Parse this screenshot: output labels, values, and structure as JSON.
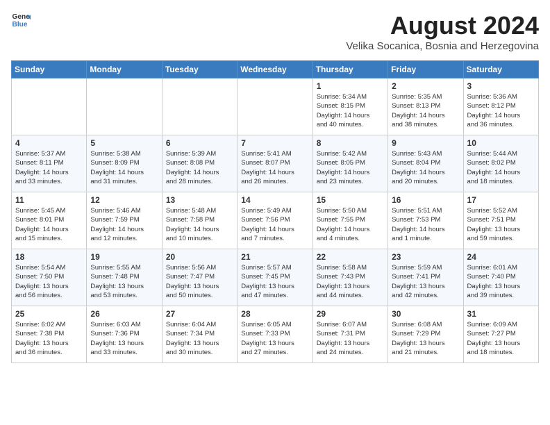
{
  "header": {
    "logo_general": "General",
    "logo_blue": "Blue",
    "month_title": "August 2024",
    "location": "Velika Socanica, Bosnia and Herzegovina"
  },
  "weekdays": [
    "Sunday",
    "Monday",
    "Tuesday",
    "Wednesday",
    "Thursday",
    "Friday",
    "Saturday"
  ],
  "weeks": [
    [
      {
        "day": "",
        "info": ""
      },
      {
        "day": "",
        "info": ""
      },
      {
        "day": "",
        "info": ""
      },
      {
        "day": "",
        "info": ""
      },
      {
        "day": "1",
        "info": "Sunrise: 5:34 AM\nSunset: 8:15 PM\nDaylight: 14 hours\nand 40 minutes."
      },
      {
        "day": "2",
        "info": "Sunrise: 5:35 AM\nSunset: 8:13 PM\nDaylight: 14 hours\nand 38 minutes."
      },
      {
        "day": "3",
        "info": "Sunrise: 5:36 AM\nSunset: 8:12 PM\nDaylight: 14 hours\nand 36 minutes."
      }
    ],
    [
      {
        "day": "4",
        "info": "Sunrise: 5:37 AM\nSunset: 8:11 PM\nDaylight: 14 hours\nand 33 minutes."
      },
      {
        "day": "5",
        "info": "Sunrise: 5:38 AM\nSunset: 8:09 PM\nDaylight: 14 hours\nand 31 minutes."
      },
      {
        "day": "6",
        "info": "Sunrise: 5:39 AM\nSunset: 8:08 PM\nDaylight: 14 hours\nand 28 minutes."
      },
      {
        "day": "7",
        "info": "Sunrise: 5:41 AM\nSunset: 8:07 PM\nDaylight: 14 hours\nand 26 minutes."
      },
      {
        "day": "8",
        "info": "Sunrise: 5:42 AM\nSunset: 8:05 PM\nDaylight: 14 hours\nand 23 minutes."
      },
      {
        "day": "9",
        "info": "Sunrise: 5:43 AM\nSunset: 8:04 PM\nDaylight: 14 hours\nand 20 minutes."
      },
      {
        "day": "10",
        "info": "Sunrise: 5:44 AM\nSunset: 8:02 PM\nDaylight: 14 hours\nand 18 minutes."
      }
    ],
    [
      {
        "day": "11",
        "info": "Sunrise: 5:45 AM\nSunset: 8:01 PM\nDaylight: 14 hours\nand 15 minutes."
      },
      {
        "day": "12",
        "info": "Sunrise: 5:46 AM\nSunset: 7:59 PM\nDaylight: 14 hours\nand 12 minutes."
      },
      {
        "day": "13",
        "info": "Sunrise: 5:48 AM\nSunset: 7:58 PM\nDaylight: 14 hours\nand 10 minutes."
      },
      {
        "day": "14",
        "info": "Sunrise: 5:49 AM\nSunset: 7:56 PM\nDaylight: 14 hours\nand 7 minutes."
      },
      {
        "day": "15",
        "info": "Sunrise: 5:50 AM\nSunset: 7:55 PM\nDaylight: 14 hours\nand 4 minutes."
      },
      {
        "day": "16",
        "info": "Sunrise: 5:51 AM\nSunset: 7:53 PM\nDaylight: 14 hours\nand 1 minute."
      },
      {
        "day": "17",
        "info": "Sunrise: 5:52 AM\nSunset: 7:51 PM\nDaylight: 13 hours\nand 59 minutes."
      }
    ],
    [
      {
        "day": "18",
        "info": "Sunrise: 5:54 AM\nSunset: 7:50 PM\nDaylight: 13 hours\nand 56 minutes."
      },
      {
        "day": "19",
        "info": "Sunrise: 5:55 AM\nSunset: 7:48 PM\nDaylight: 13 hours\nand 53 minutes."
      },
      {
        "day": "20",
        "info": "Sunrise: 5:56 AM\nSunset: 7:47 PM\nDaylight: 13 hours\nand 50 minutes."
      },
      {
        "day": "21",
        "info": "Sunrise: 5:57 AM\nSunset: 7:45 PM\nDaylight: 13 hours\nand 47 minutes."
      },
      {
        "day": "22",
        "info": "Sunrise: 5:58 AM\nSunset: 7:43 PM\nDaylight: 13 hours\nand 44 minutes."
      },
      {
        "day": "23",
        "info": "Sunrise: 5:59 AM\nSunset: 7:41 PM\nDaylight: 13 hours\nand 42 minutes."
      },
      {
        "day": "24",
        "info": "Sunrise: 6:01 AM\nSunset: 7:40 PM\nDaylight: 13 hours\nand 39 minutes."
      }
    ],
    [
      {
        "day": "25",
        "info": "Sunrise: 6:02 AM\nSunset: 7:38 PM\nDaylight: 13 hours\nand 36 minutes."
      },
      {
        "day": "26",
        "info": "Sunrise: 6:03 AM\nSunset: 7:36 PM\nDaylight: 13 hours\nand 33 minutes."
      },
      {
        "day": "27",
        "info": "Sunrise: 6:04 AM\nSunset: 7:34 PM\nDaylight: 13 hours\nand 30 minutes."
      },
      {
        "day": "28",
        "info": "Sunrise: 6:05 AM\nSunset: 7:33 PM\nDaylight: 13 hours\nand 27 minutes."
      },
      {
        "day": "29",
        "info": "Sunrise: 6:07 AM\nSunset: 7:31 PM\nDaylight: 13 hours\nand 24 minutes."
      },
      {
        "day": "30",
        "info": "Sunrise: 6:08 AM\nSunset: 7:29 PM\nDaylight: 13 hours\nand 21 minutes."
      },
      {
        "day": "31",
        "info": "Sunrise: 6:09 AM\nSunset: 7:27 PM\nDaylight: 13 hours\nand 18 minutes."
      }
    ]
  ]
}
